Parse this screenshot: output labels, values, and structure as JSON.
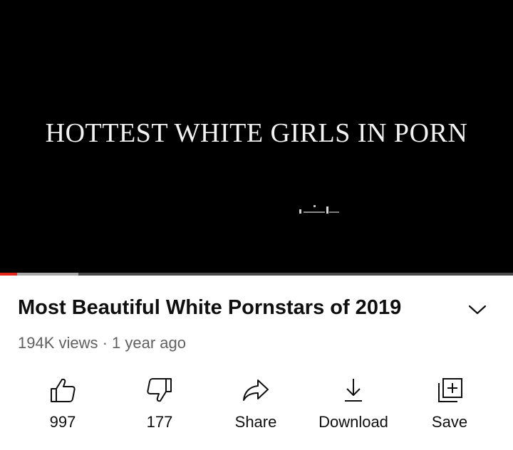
{
  "video": {
    "caption": "HOTTEST WHITE GIRLS IN PORN",
    "played_fraction": 0.034,
    "buffered_fraction": 0.153
  },
  "details": {
    "title": "Most Beautiful White Pornstars of 2019",
    "meta": "194K views · 1 year ago",
    "expand_icon": "chevron-down-icon"
  },
  "actions": [
    {
      "id": "like",
      "label": "997",
      "icon": "thumbs-up-icon"
    },
    {
      "id": "dislike",
      "label": "177",
      "icon": "thumbs-down-icon"
    },
    {
      "id": "share",
      "label": "Share",
      "icon": "share-arrow-icon"
    },
    {
      "id": "download",
      "label": "Download",
      "icon": "download-icon"
    },
    {
      "id": "save",
      "label": "Save",
      "icon": "add-to-playlist-icon"
    }
  ],
  "colors": {
    "progress_played": "#e1251b",
    "progress_buffer": "#a8a8a8",
    "progress_track": "#4b4b4b",
    "meta_text": "#606060"
  }
}
